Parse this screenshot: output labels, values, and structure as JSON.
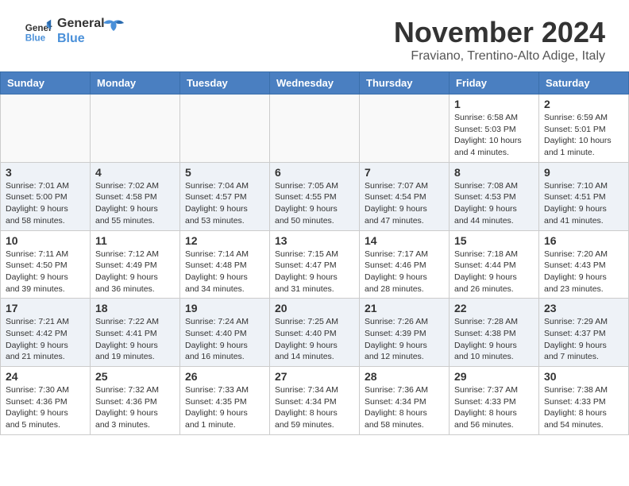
{
  "header": {
    "logo_line1": "General",
    "logo_line2": "Blue",
    "month_title": "November 2024",
    "location": "Fraviano, Trentino-Alto Adige, Italy"
  },
  "days_of_week": [
    "Sunday",
    "Monday",
    "Tuesday",
    "Wednesday",
    "Thursday",
    "Friday",
    "Saturday"
  ],
  "weeks": [
    [
      {
        "day": "",
        "info": ""
      },
      {
        "day": "",
        "info": ""
      },
      {
        "day": "",
        "info": ""
      },
      {
        "day": "",
        "info": ""
      },
      {
        "day": "",
        "info": ""
      },
      {
        "day": "1",
        "info": "Sunrise: 6:58 AM\nSunset: 5:03 PM\nDaylight: 10 hours\nand 4 minutes."
      },
      {
        "day": "2",
        "info": "Sunrise: 6:59 AM\nSunset: 5:01 PM\nDaylight: 10 hours\nand 1 minute."
      }
    ],
    [
      {
        "day": "3",
        "info": "Sunrise: 7:01 AM\nSunset: 5:00 PM\nDaylight: 9 hours\nand 58 minutes."
      },
      {
        "day": "4",
        "info": "Sunrise: 7:02 AM\nSunset: 4:58 PM\nDaylight: 9 hours\nand 55 minutes."
      },
      {
        "day": "5",
        "info": "Sunrise: 7:04 AM\nSunset: 4:57 PM\nDaylight: 9 hours\nand 53 minutes."
      },
      {
        "day": "6",
        "info": "Sunrise: 7:05 AM\nSunset: 4:55 PM\nDaylight: 9 hours\nand 50 minutes."
      },
      {
        "day": "7",
        "info": "Sunrise: 7:07 AM\nSunset: 4:54 PM\nDaylight: 9 hours\nand 47 minutes."
      },
      {
        "day": "8",
        "info": "Sunrise: 7:08 AM\nSunset: 4:53 PM\nDaylight: 9 hours\nand 44 minutes."
      },
      {
        "day": "9",
        "info": "Sunrise: 7:10 AM\nSunset: 4:51 PM\nDaylight: 9 hours\nand 41 minutes."
      }
    ],
    [
      {
        "day": "10",
        "info": "Sunrise: 7:11 AM\nSunset: 4:50 PM\nDaylight: 9 hours\nand 39 minutes."
      },
      {
        "day": "11",
        "info": "Sunrise: 7:12 AM\nSunset: 4:49 PM\nDaylight: 9 hours\nand 36 minutes."
      },
      {
        "day": "12",
        "info": "Sunrise: 7:14 AM\nSunset: 4:48 PM\nDaylight: 9 hours\nand 34 minutes."
      },
      {
        "day": "13",
        "info": "Sunrise: 7:15 AM\nSunset: 4:47 PM\nDaylight: 9 hours\nand 31 minutes."
      },
      {
        "day": "14",
        "info": "Sunrise: 7:17 AM\nSunset: 4:46 PM\nDaylight: 9 hours\nand 28 minutes."
      },
      {
        "day": "15",
        "info": "Sunrise: 7:18 AM\nSunset: 4:44 PM\nDaylight: 9 hours\nand 26 minutes."
      },
      {
        "day": "16",
        "info": "Sunrise: 7:20 AM\nSunset: 4:43 PM\nDaylight: 9 hours\nand 23 minutes."
      }
    ],
    [
      {
        "day": "17",
        "info": "Sunrise: 7:21 AM\nSunset: 4:42 PM\nDaylight: 9 hours\nand 21 minutes."
      },
      {
        "day": "18",
        "info": "Sunrise: 7:22 AM\nSunset: 4:41 PM\nDaylight: 9 hours\nand 19 minutes."
      },
      {
        "day": "19",
        "info": "Sunrise: 7:24 AM\nSunset: 4:40 PM\nDaylight: 9 hours\nand 16 minutes."
      },
      {
        "day": "20",
        "info": "Sunrise: 7:25 AM\nSunset: 4:40 PM\nDaylight: 9 hours\nand 14 minutes."
      },
      {
        "day": "21",
        "info": "Sunrise: 7:26 AM\nSunset: 4:39 PM\nDaylight: 9 hours\nand 12 minutes."
      },
      {
        "day": "22",
        "info": "Sunrise: 7:28 AM\nSunset: 4:38 PM\nDaylight: 9 hours\nand 10 minutes."
      },
      {
        "day": "23",
        "info": "Sunrise: 7:29 AM\nSunset: 4:37 PM\nDaylight: 9 hours\nand 7 minutes."
      }
    ],
    [
      {
        "day": "24",
        "info": "Sunrise: 7:30 AM\nSunset: 4:36 PM\nDaylight: 9 hours\nand 5 minutes."
      },
      {
        "day": "25",
        "info": "Sunrise: 7:32 AM\nSunset: 4:36 PM\nDaylight: 9 hours\nand 3 minutes."
      },
      {
        "day": "26",
        "info": "Sunrise: 7:33 AM\nSunset: 4:35 PM\nDaylight: 9 hours\nand 1 minute."
      },
      {
        "day": "27",
        "info": "Sunrise: 7:34 AM\nSunset: 4:34 PM\nDaylight: 8 hours\nand 59 minutes."
      },
      {
        "day": "28",
        "info": "Sunrise: 7:36 AM\nSunset: 4:34 PM\nDaylight: 8 hours\nand 58 minutes."
      },
      {
        "day": "29",
        "info": "Sunrise: 7:37 AM\nSunset: 4:33 PM\nDaylight: 8 hours\nand 56 minutes."
      },
      {
        "day": "30",
        "info": "Sunrise: 7:38 AM\nSunset: 4:33 PM\nDaylight: 8 hours\nand 54 minutes."
      }
    ]
  ]
}
